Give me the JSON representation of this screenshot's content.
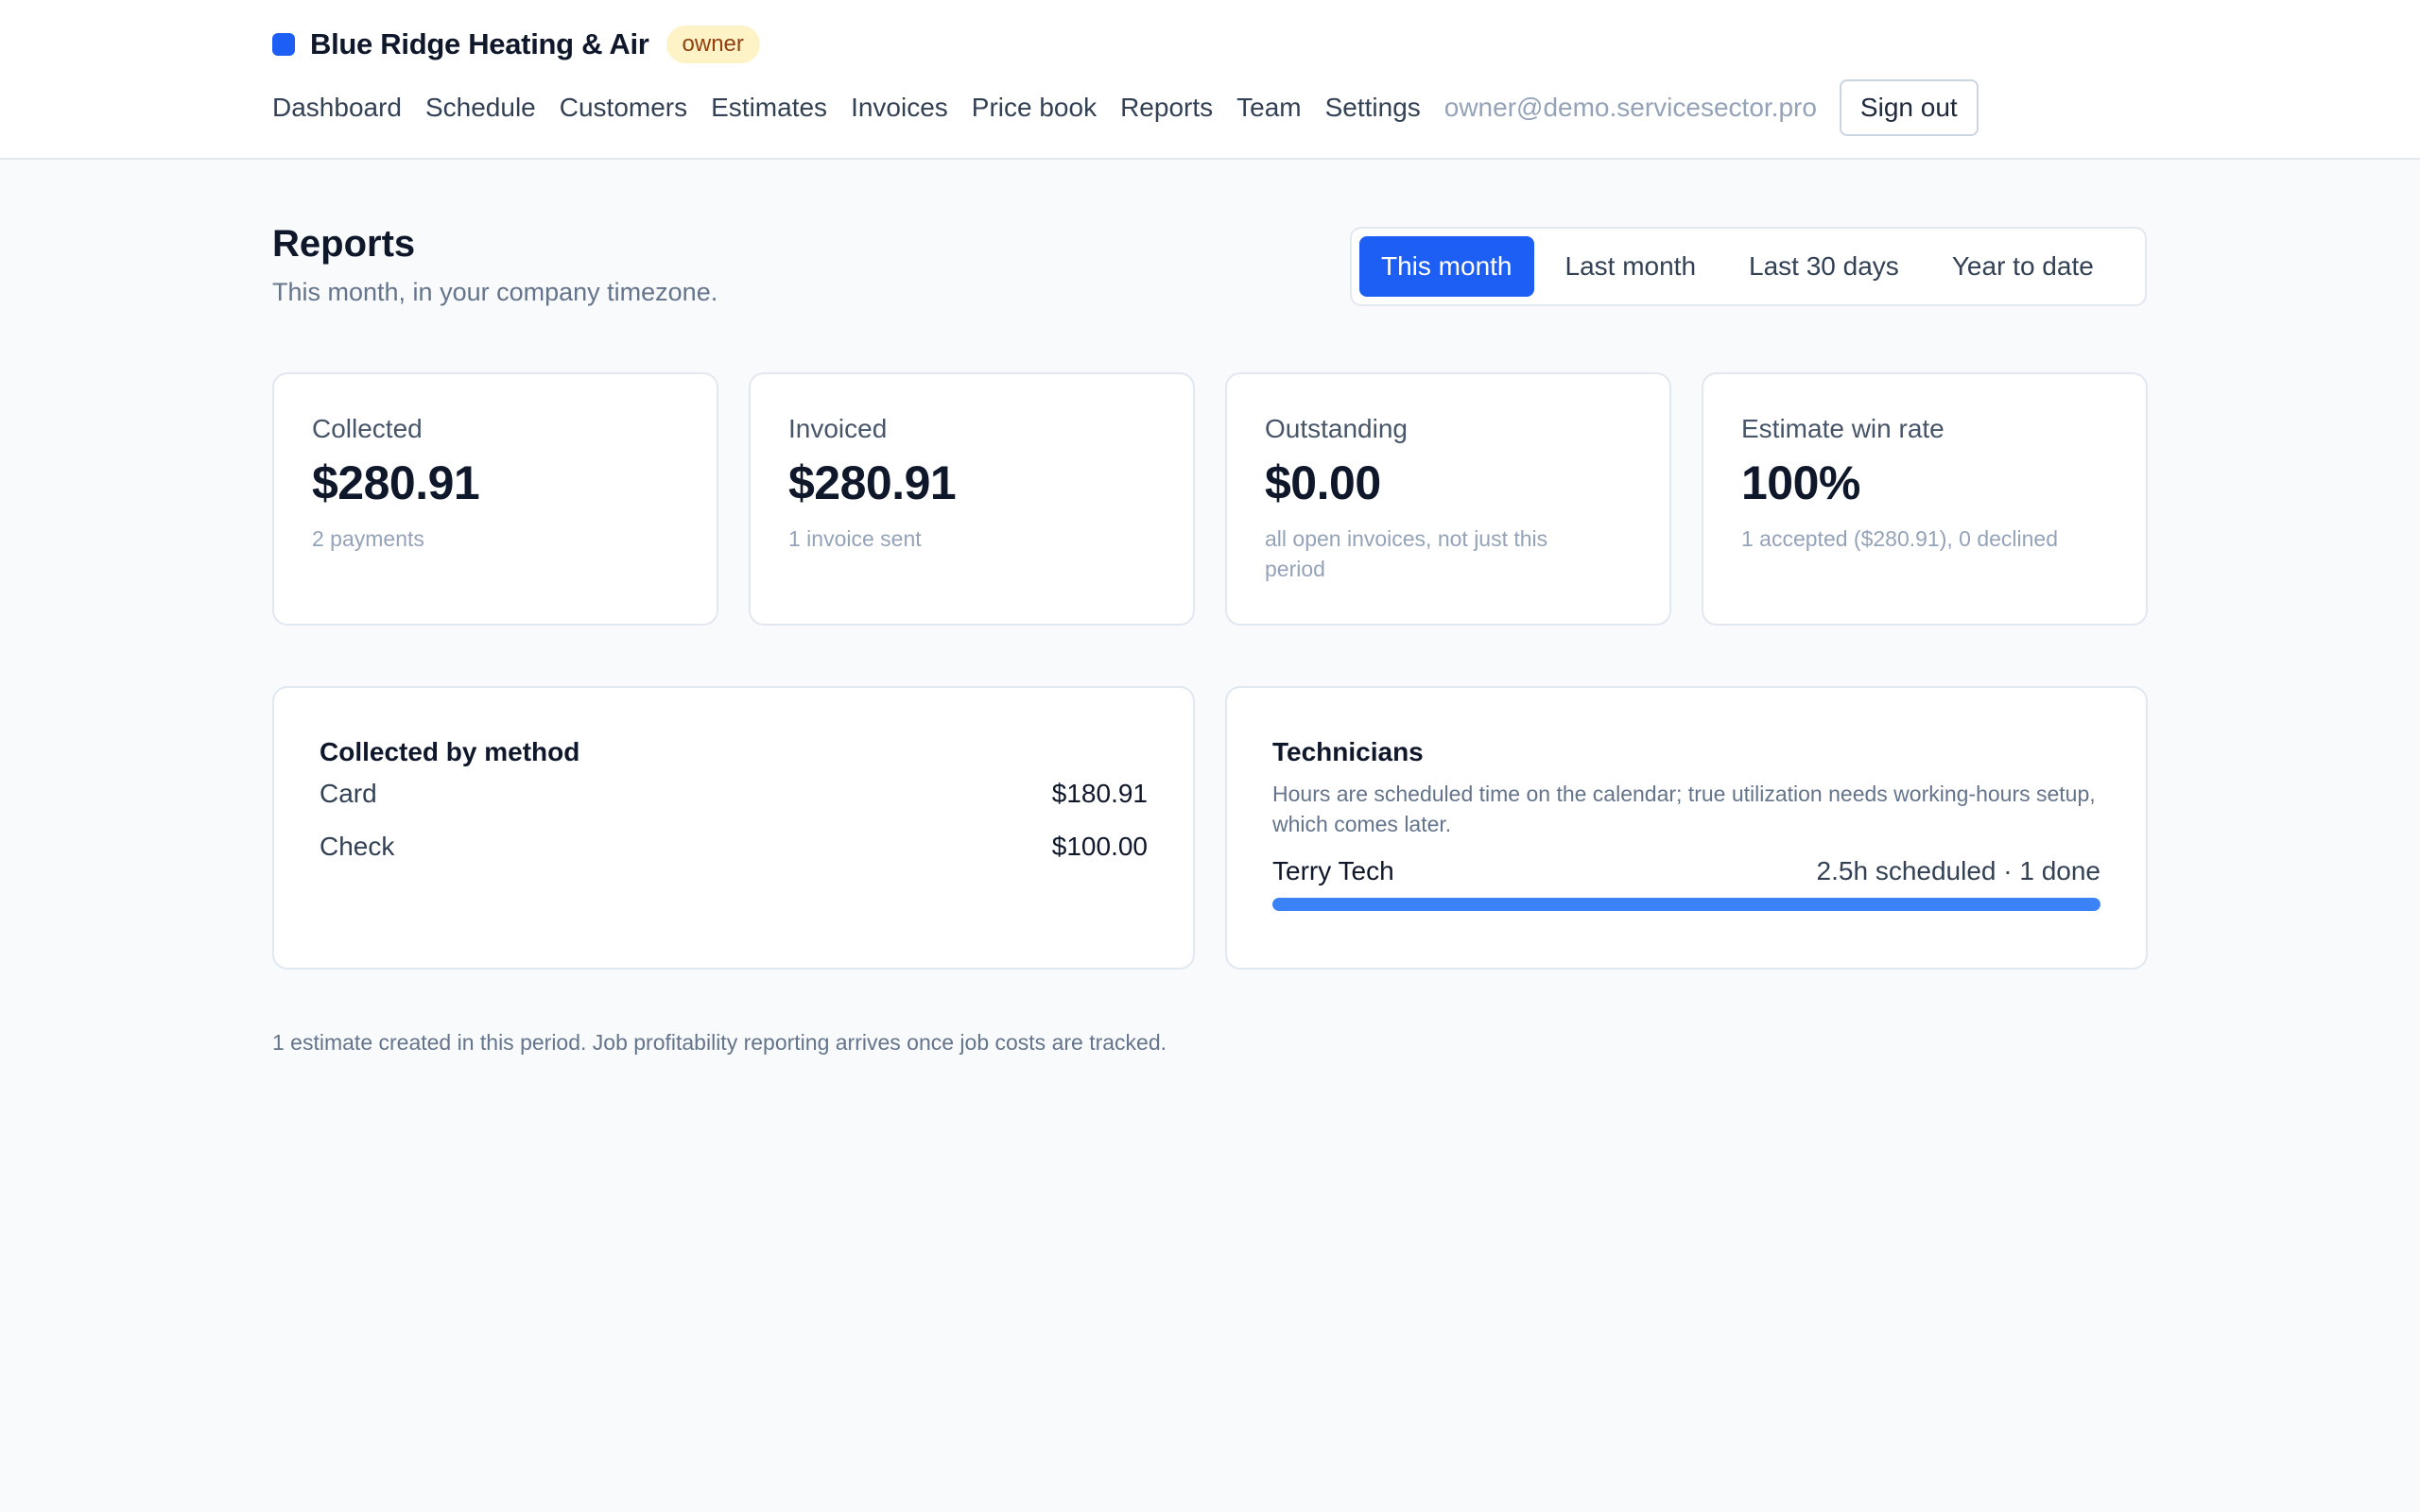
{
  "header": {
    "company_name": "Blue Ridge Heating & Air",
    "role_badge": "owner",
    "brand_color": "#1d5ef5",
    "nav": [
      "Dashboard",
      "Schedule",
      "Customers",
      "Estimates",
      "Invoices",
      "Price book",
      "Reports",
      "Team",
      "Settings"
    ],
    "user_email": "owner@demo.servicesector.pro",
    "signout_label": "Sign out"
  },
  "page": {
    "title": "Reports",
    "subtitle": "This month, in your company timezone."
  },
  "range_options": {
    "selected": "This month",
    "items": [
      "This month",
      "Last month",
      "Last 30 days",
      "Year to date"
    ]
  },
  "stats": [
    {
      "label": "Collected",
      "value": "$280.91",
      "note": "2 payments"
    },
    {
      "label": "Invoiced",
      "value": "$280.91",
      "note": "1 invoice sent"
    },
    {
      "label": "Outstanding",
      "value": "$0.00",
      "note": "all open invoices, not just this period"
    },
    {
      "label": "Estimate win rate",
      "value": "100%",
      "note": "1 accepted ($280.91), 0 declined"
    }
  ],
  "collected_by_method": {
    "title": "Collected by method",
    "rows": [
      {
        "method": "Card",
        "amount": "$180.91"
      },
      {
        "method": "Check",
        "amount": "$100.00"
      }
    ]
  },
  "technicians": {
    "title": "Technicians",
    "description": "Hours are scheduled time on the calendar; true utilization needs working-hours setup, which comes later.",
    "rows": [
      {
        "name": "Terry Tech",
        "summary": "2.5h scheduled · 1 done",
        "utilization": 1.0
      }
    ]
  },
  "footnote": "1 estimate created in this period. Job profitability reporting arrives once job costs are tracked."
}
